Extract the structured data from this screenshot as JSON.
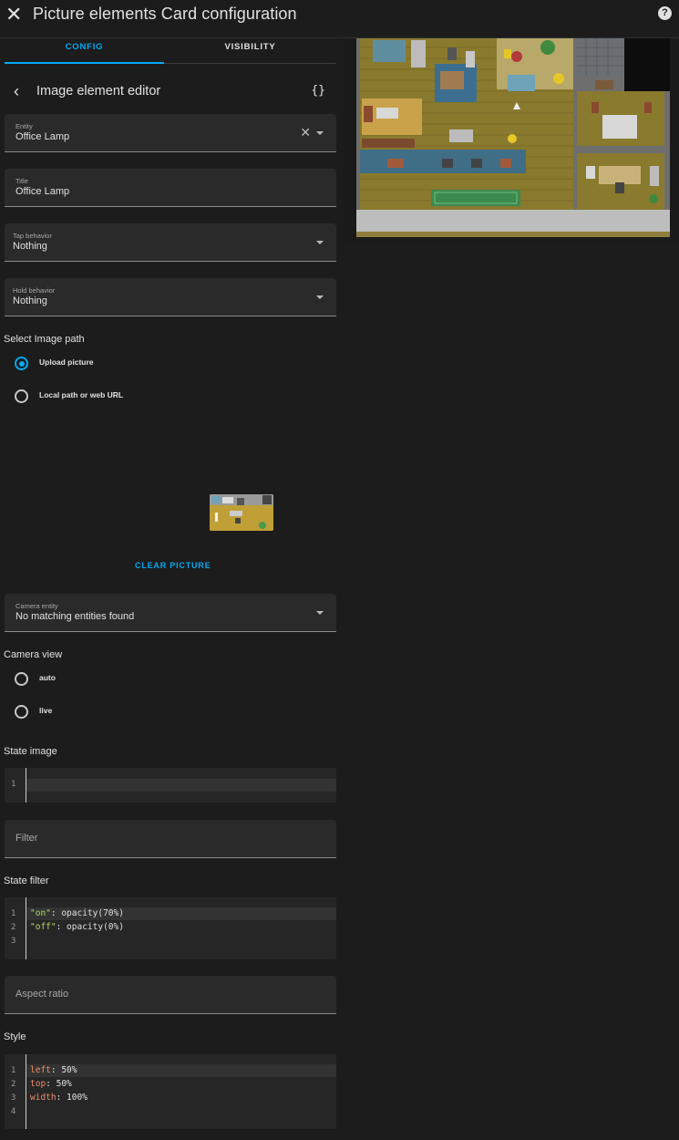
{
  "header": {
    "close_icon": "close-icon",
    "title": "Picture elements Card configuration",
    "help_icon": "help-circle-icon",
    "help_glyph": "?"
  },
  "tabs": [
    {
      "label": "CONFIG",
      "active": true
    },
    {
      "label": "VISIBILITY",
      "active": false
    }
  ],
  "editor": {
    "back_icon": "chevron-left-icon",
    "title": "Image element editor",
    "code_toggle": "{}"
  },
  "entity": {
    "label": "Entity",
    "value": "Office Lamp"
  },
  "title_field": {
    "label": "Title",
    "value": "Office Lamp"
  },
  "tap_behavior": {
    "label": "Tap behavior",
    "value": "Nothing"
  },
  "hold_behavior": {
    "label": "Hold behavior",
    "value": "Nothing"
  },
  "image_path": {
    "label": "Select Image path",
    "options": [
      {
        "label": "Upload picture",
        "selected": true
      },
      {
        "label": "Local path or web URL",
        "selected": false
      }
    ],
    "clear_label": "CLEAR PICTURE"
  },
  "camera_entity": {
    "label": "Camera entity",
    "value": "No matching entities found"
  },
  "camera_view": {
    "label": "Camera view",
    "options": [
      {
        "label": "auto",
        "selected": false
      },
      {
        "label": "live",
        "selected": false
      }
    ]
  },
  "state_image": {
    "label": "State image",
    "lines": [
      {
        "n": "1",
        "text": ""
      }
    ]
  },
  "filter": {
    "placeholder": "Filter"
  },
  "state_filter": {
    "label": "State filter",
    "lines": [
      {
        "n": "1",
        "key": "\"on\"",
        "val": ": opacity(70%)"
      },
      {
        "n": "2",
        "key": "\"off\"",
        "val": ": opacity(0%)"
      },
      {
        "n": "3",
        "key": "",
        "val": ""
      }
    ]
  },
  "aspect_ratio": {
    "placeholder": "Aspect ratio"
  },
  "style": {
    "label": "Style",
    "lines": [
      {
        "n": "1",
        "key": "left",
        "val": ": 50%"
      },
      {
        "n": "2",
        "key": "top",
        "val": ": 50%"
      },
      {
        "n": "3",
        "key": "width",
        "val": ": 100%"
      },
      {
        "n": "4",
        "key": "",
        "val": ""
      }
    ]
  },
  "colors": {
    "accent": "#03a9f4",
    "background": "#1c1c1c",
    "field": "#2a2a2a"
  }
}
